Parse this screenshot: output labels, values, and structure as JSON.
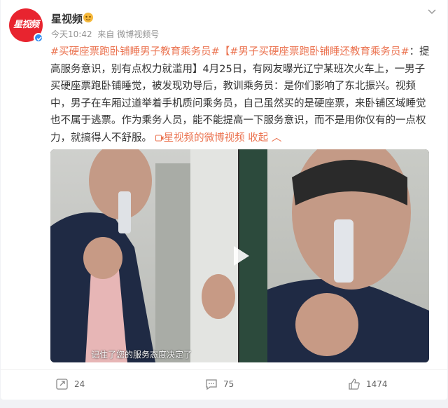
{
  "post": {
    "author": "星视频",
    "avatar_text": "星视频",
    "time": "今天10:42",
    "source": "来自 微博视频号",
    "hashtag1": "#买硬座票跑卧铺睡男子教育乘务员#",
    "hashtag2": "【#男子买硬座票跑卧铺睡还教育乘务员#",
    "line1_tail": "：提高服",
    "text_rest": "务意识，别有点权力就滥用】4月25日，有网友曝光辽宁某班次火车上，一男子买硬座票跑卧铺睡觉，被发现劝导后，教训乘务员：是你们影响了东北振兴。视频中，男子在车厢过道举着手机质问乘务员，自己虽然买的是硬座票，来卧铺区域睡觉也不属于逃票。作为乘务人员，能不能提高一下服务意识，而不是用你仅有的一点权力，就搞得人不舒服。",
    "video_link": "星视频的微博视频",
    "collapse": "收起",
    "subtitle": "记住了您的服务态度决定了"
  },
  "actions": {
    "repost": "24",
    "comment": "75",
    "like": "1474"
  },
  "colors": {
    "accent": "#eb7350",
    "brand_red": "#e8242f",
    "verified_blue": "#2f8cf2"
  },
  "icons": [
    "more-icon",
    "verified-icon",
    "badge-icon",
    "link-icon",
    "play-icon",
    "repost-icon",
    "comment-icon",
    "like-icon"
  ]
}
